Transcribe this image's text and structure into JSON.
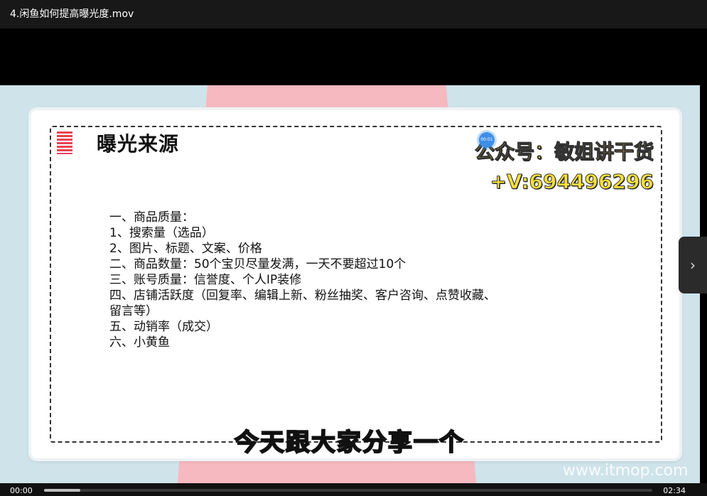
{
  "window": {
    "title": "4.闲鱼如何提高曝光度.mov"
  },
  "slide": {
    "heading": "曝光来源",
    "promo_line1": "公众号：敏姐讲干货",
    "promo_line2": "+V:694496296",
    "items": [
      "一、商品质量：",
      "1、搜索量（选品）",
      "2、图片、标题、文案、价格",
      "二、商品数量：50个宝贝尽量发满，一天不要超过10个",
      "三、账号质量：信誉度、个人IP装修",
      "四、店铺活跃度（回复率、编辑上新、粉丝抽奖、客户咨询、点赞收藏、",
      "留言等）",
      "五、动销率（成交）",
      "六、小黄鱼"
    ],
    "subtitle": "今天跟大家分享一个",
    "watermark": "www.itmop.com",
    "marker_time": "00:01"
  },
  "player": {
    "current_time": "00:00",
    "total_time": "02:34",
    "progress_fraction": 0.06,
    "next_icon": "chevron-right-icon"
  }
}
